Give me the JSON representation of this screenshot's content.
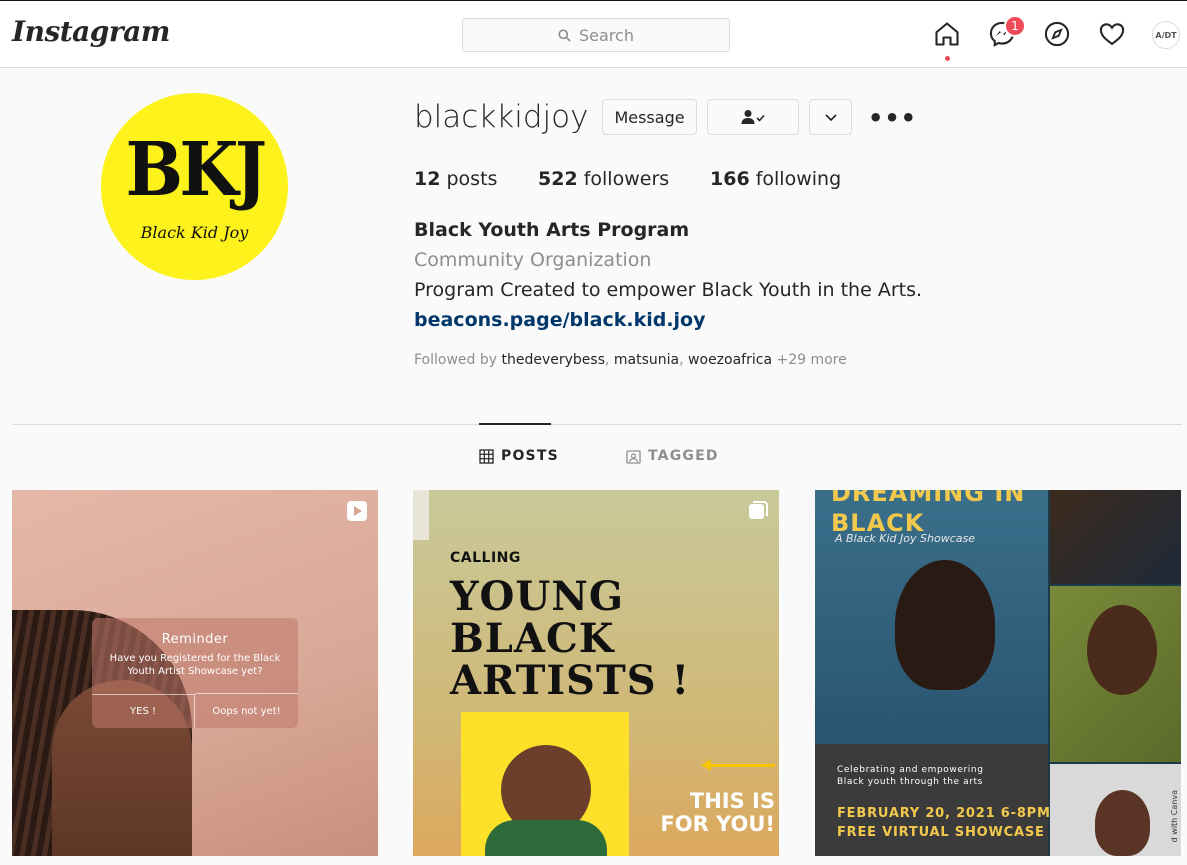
{
  "nav": {
    "logo": "Instagram",
    "search_placeholder": "Search",
    "messages_badge": "1",
    "avatar_text": "A/DT"
  },
  "profile": {
    "username": "blackkidjoy",
    "avatar": {
      "letters": "BKJ",
      "subtitle": "Black Kid Joy",
      "bg_color": "#fdf21c"
    },
    "buttons": {
      "message": "Message"
    },
    "stats": {
      "posts_num": "12",
      "posts_label": "posts",
      "followers_num": "522",
      "followers_label": "followers",
      "following_num": "166",
      "following_label": "following"
    },
    "bio": {
      "name": "Black Youth Arts Program",
      "category": "Community Organization",
      "description": "Program Created to empower Black Youth in the Arts.",
      "link": "beacons.page/black.kid.joy"
    },
    "followed_by": {
      "prefix": "Followed by",
      "user1": "thedeverybess",
      "user2": "matsunia",
      "user3": "woezoafrica",
      "more": "+29 more"
    }
  },
  "tabs": {
    "posts": "POSTS",
    "tagged": "TAGGED"
  },
  "posts": [
    {
      "reminder_title": "Reminder",
      "reminder_body": "Have you Registered for the Black Youth Artist Showcase yet?",
      "yes": "YES !",
      "no": "Oops not yet!"
    },
    {
      "calling": "CALLING",
      "headline_1": "YOUNG",
      "headline_2": "BLACK",
      "headline_3": "ARTISTS !",
      "cta_1": "THIS IS",
      "cta_2": "FOR YOU!"
    },
    {
      "title_1": "DREAMING IN",
      "title_2": "BLACK",
      "subtitle": "A Black Kid Joy Showcase",
      "celebrating_1": "Celebrating and empowering",
      "celebrating_2": "Black youth through the arts",
      "date_1": "FEBRUARY 20, 2021 6-8PM",
      "date_2": "FREE VIRTUAL SHOWCASE",
      "watermark": "d with Canva"
    }
  ],
  "colors": {
    "accent_red": "#ed4956",
    "link_blue": "#00376b",
    "border": "#dbdbdb"
  }
}
